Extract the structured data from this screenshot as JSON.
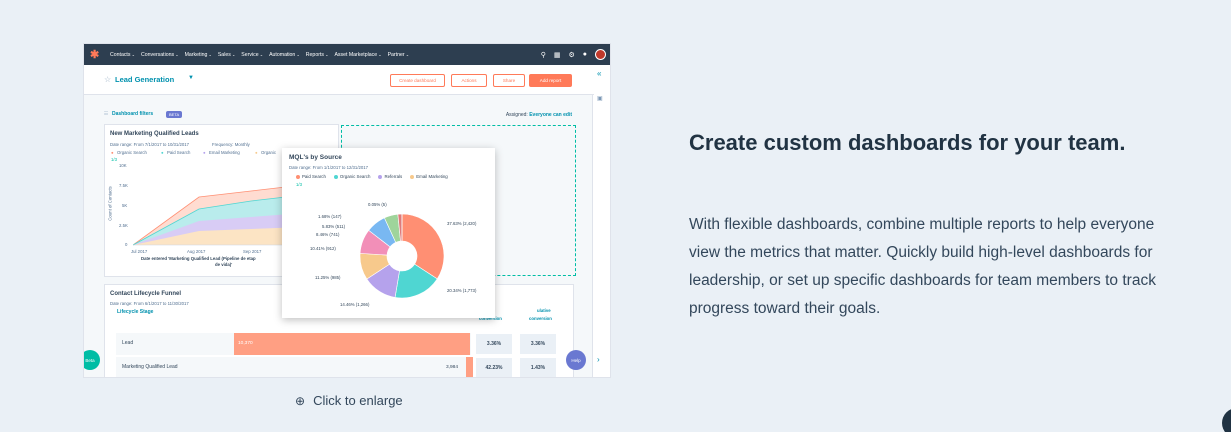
{
  "screenshot": {
    "nav": {
      "items": [
        "Contacts",
        "Conversations",
        "Marketing",
        "Sales",
        "Service",
        "Automation",
        "Reports",
        "Asset Marketplace",
        "Partner"
      ]
    },
    "header": {
      "title": "Lead Generation",
      "buttons": {
        "create": "Create dashboard",
        "actions": "Actions",
        "share": "Share",
        "add_report": "Add report"
      }
    },
    "filters_label": "Dashboard filters",
    "beta_label": "BETA",
    "assigned_label": "Assigned:",
    "assigned_value": "Everyone can edit",
    "new_mql_card": {
      "title": "New Marketing Qualified Leads",
      "date_range": "Date range: From 7/1/2017 to 10/31/2017",
      "frequency": "Frequency: Monthly",
      "legend": [
        "Organic Search",
        "Paid Search",
        "Email Marketing",
        "Organic"
      ],
      "pager": "1/3",
      "y_ticks": [
        "10K",
        "7.5K",
        "5K",
        "2.5K",
        "0"
      ],
      "y_label": "Count of Contacts",
      "x_ticks": [
        "Jul 2017",
        "Aug 2017",
        "Sep 2017"
      ],
      "x_label": "Date entered 'Marketing Qualified Lead (Pipeline de etap",
      "x_label_2": "de vida)'"
    },
    "mql_source": {
      "title": "MQL's by Source",
      "date_range": "Date range: From 1/1/2017 to 12/31/2017",
      "legend": [
        "Paid Search",
        "Organic Search",
        "Referrals",
        "Email Marketing"
      ],
      "pager": "1/3",
      "slices": [
        {
          "label": "37.63% (2,420)",
          "value": 37.63,
          "color": "#ff8f73"
        },
        {
          "label": "20.34% (1,773)",
          "value": 20.34,
          "color": "#4fd6d2"
        },
        {
          "label": "14.46% (1,266)",
          "value": 14.46,
          "color": "#b5a2ec"
        },
        {
          "label": "11.25% (985)",
          "value": 11.25,
          "color": "#f7c98c"
        },
        {
          "label": "10.41% (912)",
          "value": 10.41,
          "color": "#f28fb8"
        },
        {
          "label": "8.46% (741)",
          "value": 8.46,
          "color": "#79b8f2"
        },
        {
          "label": "5.83% (511)",
          "value": 5.83,
          "color": "#9fd49b"
        },
        {
          "label": "1.68% (147)",
          "value": 1.68,
          "color": "#e07a7a"
        },
        {
          "label": "0.05% (5)",
          "value": 0.05,
          "color": "#6d8fb3"
        }
      ]
    },
    "funnel": {
      "title": "Contact Lifecycle Funnel",
      "date_range": "Date range: From 6/1/2017 to 11/30/2017",
      "stage_label": "Lifecycle Stage",
      "col1": "conversion",
      "col2_a": "ulative",
      "col2_b": "conversion",
      "rows": [
        {
          "label": "Lead",
          "value": "10,370",
          "fraction": 1.0,
          "pct1": "3.36%",
          "pct2": "3.36%"
        },
        {
          "label": "Marketing Qualified Lead",
          "value": "3,984",
          "fraction": 0.03,
          "pct1": "42.23%",
          "pct2": "1.43%"
        }
      ]
    },
    "beta_button": "Beta",
    "help_button": "Help"
  },
  "caption": {
    "text": "Click to enlarge",
    "icon": "zoom-in-icon"
  },
  "feature": {
    "headline": "Create custom dashboards for your team.",
    "body": "With flexible dashboards, combine multiple reports to help everyone view the metrics that matter. Quickly build high-level dashboards for leadership, or set up specific dashboards for team members to track progress toward their goals."
  },
  "colors": {
    "accent": "#ff7a59",
    "teal": "#0091ae",
    "nav_bg": "#2d3e50",
    "page_bg": "#eaf0f6"
  }
}
